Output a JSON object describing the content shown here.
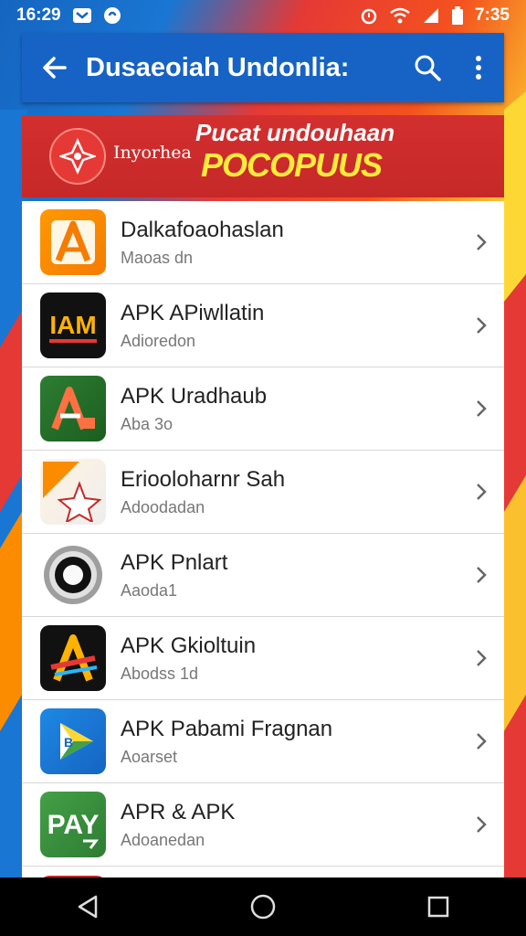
{
  "status": {
    "time_left": "16:29",
    "time_right": "7:35"
  },
  "app_bar": {
    "title": "Dusaeoiah Undonlia:"
  },
  "banner": {
    "headline_top": "Pucat undouhaan",
    "headline_main": "POCOPUUS",
    "brand_text": "Inyorhea"
  },
  "apps": [
    {
      "name": "Dalkafoaohaslan",
      "meta": "Maoas dn",
      "icon": "letter-a-orange-icon"
    },
    {
      "name": "APK APiwllatin",
      "meta": "Adioredon",
      "icon": "iam-black-icon"
    },
    {
      "name": "APK Uradhaub",
      "meta": "Aba 3o",
      "icon": "letter-a-green-icon"
    },
    {
      "name": "Eriooloharnr Sah",
      "meta": "Adoodadan",
      "icon": "star-orange-icon"
    },
    {
      "name": "APK Pnlart",
      "meta": "Aaoda1",
      "icon": "ring-icon"
    },
    {
      "name": "APK Gkioltuin",
      "meta": "Abodss 1d",
      "icon": "letter-a-dark-icon"
    },
    {
      "name": "APK Pabami Fragnan",
      "meta": "Aoarset",
      "icon": "play-arrow-blue-icon"
    },
    {
      "name": "APR & APK",
      "meta": "Adoanedan",
      "icon": "pay-green-icon"
    }
  ],
  "colors": {
    "app_bar": "#1763c5",
    "banner": "#c62828",
    "banner_accent": "#ffeb3b"
  }
}
